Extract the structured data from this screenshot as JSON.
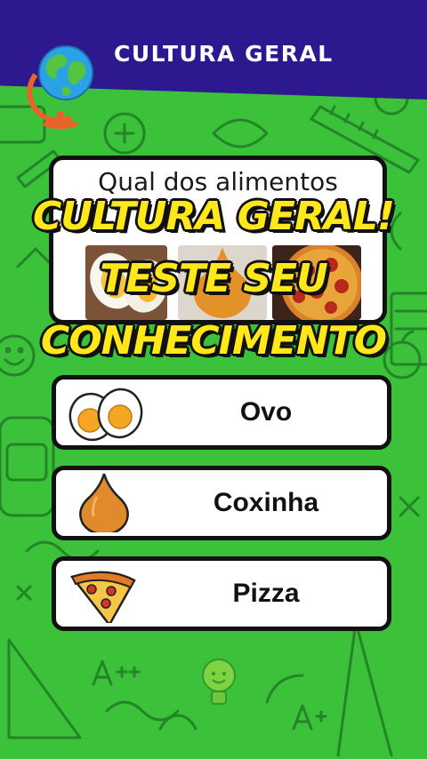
{
  "header": {
    "title": "CULTURA GERAL",
    "colors": {
      "bar": "#2e1890",
      "title": "#ffffff"
    }
  },
  "question": {
    "text": "Qual dos alimentos",
    "images": [
      "eggs-image",
      "coxinha-image",
      "pizza-image"
    ]
  },
  "promo": {
    "line1": "CULTURA GERAL!",
    "line2": "TESTE SEU",
    "line3": "CONHECIMENTO",
    "color": "#ffe81a"
  },
  "answers": [
    {
      "label": "Ovo",
      "icon": "egg-icon"
    },
    {
      "label": "Coxinha",
      "icon": "coxinha-icon"
    },
    {
      "label": "Pizza",
      "icon": "pizza-slice-icon"
    }
  ],
  "background": {
    "color": "#3cc23a",
    "doodle_color": "#1f7a26"
  }
}
